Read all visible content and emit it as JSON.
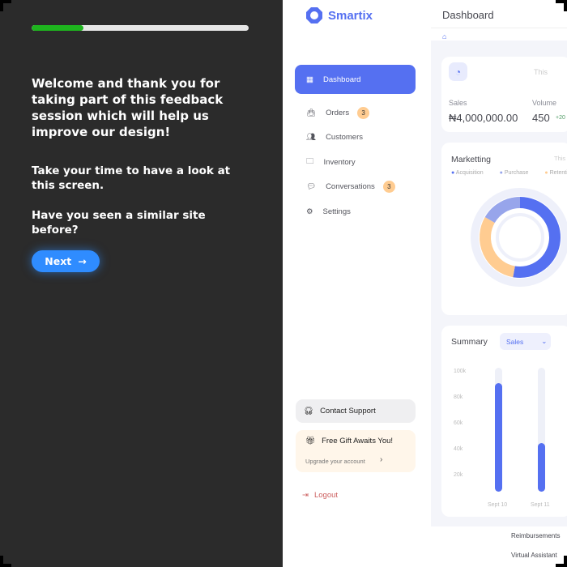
{
  "survey": {
    "progress_percent": 24,
    "welcome": "Welcome and thank you for taking part of this feedback session which will help us improve our design!",
    "instruction": "Take your time to have a look at this screen.",
    "question": "Have you seen a similar site before?",
    "next_label": "Next"
  },
  "app": {
    "brand": "Smartix",
    "page_title": "Dashboard",
    "sidebar": {
      "items": [
        {
          "label": "Dashboard"
        },
        {
          "label": "Orders",
          "badge": "3"
        },
        {
          "label": "Customers"
        },
        {
          "label": "Inventory"
        },
        {
          "label": "Conversations",
          "badge": "3"
        },
        {
          "label": "Settings"
        }
      ],
      "support": "Contact Support",
      "gift_title": "Free Gift Awaits You!",
      "gift_link": "Upgrade your account",
      "logout": "Logout"
    },
    "sales_card": {
      "period": "This",
      "sales_label": "Sales",
      "sales_value": "₦4,000,000.00",
      "volume_label": "Volume",
      "volume_value": "450",
      "volume_change": "+20"
    },
    "marketing": {
      "title": "Marketting",
      "period": "This",
      "legend": [
        {
          "label": "Acquisition",
          "color": "#5570f1"
        },
        {
          "label": "Purchase",
          "color": "#97a5eb"
        },
        {
          "label": "Retention",
          "color": "#ffcc91"
        }
      ]
    },
    "summary": {
      "title": "Summary",
      "filter": "Sales"
    },
    "footer_links": [
      "Reimbursements",
      "Virtual Assistant"
    ]
  },
  "chart_data": {
    "type": "bar",
    "categories": [
      "Sept 10",
      "Sept 11"
    ],
    "values": [
      90000,
      40000
    ],
    "yticks": [
      "100k",
      "80k",
      "60k",
      "40k",
      "20k"
    ],
    "ylim": [
      0,
      100000
    ]
  }
}
